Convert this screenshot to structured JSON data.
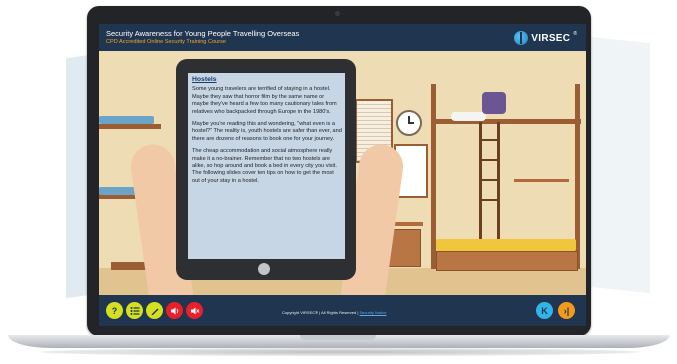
{
  "app": {
    "title": "Security Awareness for Young People Travelling Overseas",
    "subtitle": "CPD Accredited Online Security Training Course",
    "logo_text": "VIRSEC",
    "logo_reg": "®"
  },
  "slide": {
    "heading": "Hostels",
    "paragraphs": [
      "Some young travelers are terrified of staying in a hostel. Maybe they saw that horror film by the same name or maybe they've heard a few too many cautionary tales from relatives who backpacked through Europe in the 1980's.",
      "Maybe you're reading this and wondering, \"what even is a hostel?\" The reality is, youth hostels are safer than ever, and there are dozens of reasons to book one for your journey.",
      "The cheap accommodation and social atmosphere really make it a no-brainer. Remember that no two hostels are alike, so hop around and book a bed in every city you visit. The following slides cover ten tips on how to get the most out of your stay in a hostel."
    ]
  },
  "controls": {
    "help": {
      "label": "?",
      "icon": "question-icon",
      "color": "#d4e021"
    },
    "menu": {
      "icon": "list-icon",
      "color": "#d4e021"
    },
    "notes": {
      "icon": "pencil-icon",
      "color": "#d4e021"
    },
    "audio": {
      "icon": "speaker-icon",
      "color": "#e8202a"
    },
    "mute": {
      "icon": "speaker-mute-icon",
      "color": "#e8202a"
    },
    "prev": {
      "label": "K",
      "icon": "previous-icon",
      "color": "#32b4e8"
    },
    "next": {
      "label": "›|",
      "icon": "next-icon",
      "color": "#f39a1c"
    }
  },
  "footer": {
    "copyright": "Copyright VIRSEC® | All Rights Reserved |",
    "link": "Security Notice"
  }
}
